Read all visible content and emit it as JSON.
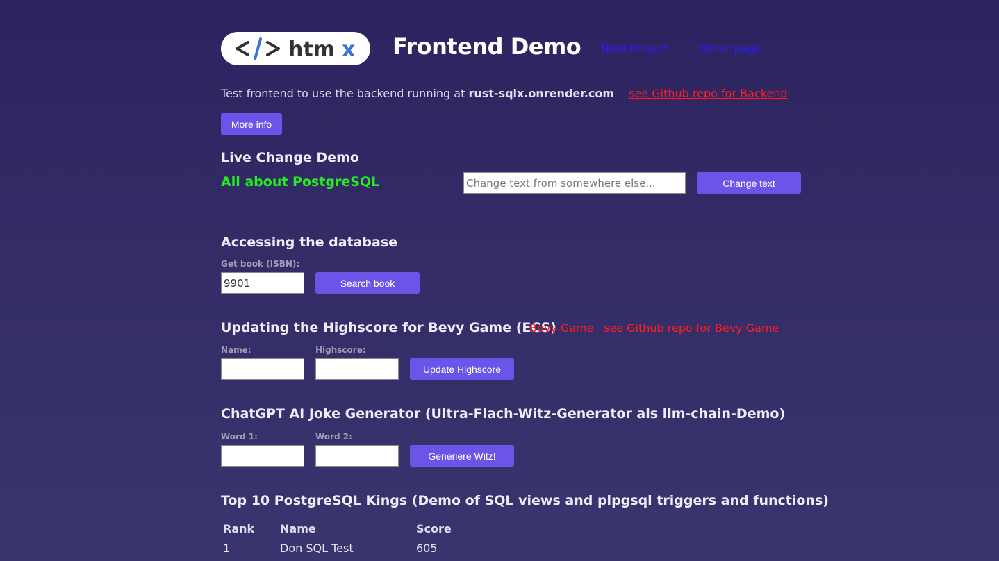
{
  "header": {
    "logo_text": "</> htmx",
    "title": "Frontend Demo",
    "nav": [
      "Next Project",
      "Other page"
    ]
  },
  "intro": {
    "text": "Test frontend to use the backend running at",
    "host": "rust-sqlx.onrender.com",
    "repo_link": "see Github repo for Backend",
    "more_info": "More info"
  },
  "live": {
    "heading": "Live Change Demo",
    "text": "All about PostgreSQL",
    "input_placeholder": "Change text from somewhere else...",
    "button": "Change text"
  },
  "db": {
    "heading": "Accessing the database",
    "label": "Get book (ISBN):",
    "value": "9901",
    "button": "Search book"
  },
  "highscore": {
    "heading": "Updating the Highscore for Bevy Game (ECS)",
    "link_game": "Bevy Game",
    "link_repo": "see Github repo for Bevy Game",
    "name_label": "Name:",
    "score_label": "Highscore:",
    "button": "Update Highscore"
  },
  "joke": {
    "heading": "ChatGPT AI Joke Generator (Ultra-Flach-Witz-Generator als llm-chain-Demo)",
    "word1_label": "Word 1:",
    "word2_label": "Word 2:",
    "button": "Generiere Witz!"
  },
  "kings": {
    "heading": "Top 10 PostgreSQL Kings (Demo of SQL views and plpgsql triggers and functions)",
    "columns": [
      "Rank",
      "Name",
      "Score"
    ],
    "rows": [
      [
        "1",
        "Don SQL Test",
        "605"
      ]
    ]
  },
  "colors": {
    "background": "#2c2360",
    "accent_button": "#6a55e8",
    "link_red": "#ff1e1e",
    "nav_blue": "#2b1bff",
    "highlight_green": "#22ee22"
  }
}
